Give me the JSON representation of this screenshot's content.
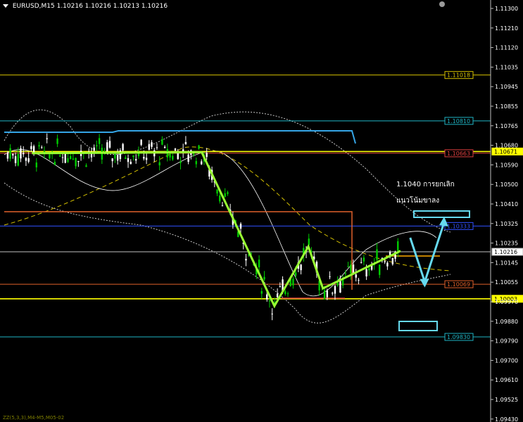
{
  "header": {
    "symbol": "EURUSD,M15",
    "quote": "1.10216 1.10216 1.10213 1.10216"
  },
  "footer": {
    "indicator": "ZZ(5,3,3),M4-M5,M05-02"
  },
  "annotation": {
    "line1": "1.1040 การยกเลิก",
    "line2": "แนวโน้มขาลง"
  },
  "colors": {
    "background": "#000000",
    "bull": "#00cc00",
    "bear": "#ffffff",
    "zigzag": "#99ff33",
    "arrow": "#66d9ef"
  },
  "chart_data": {
    "type": "candlestick",
    "title": "",
    "xlabel": "",
    "ylabel": "",
    "ylim": [
      1.0946,
      1.1132
    ],
    "y_ticks": [
      "1.11300",
      "1.11210",
      "1.11120",
      "1.11035",
      "1.10945",
      "1.10855",
      "1.10765",
      "1.10680",
      "1.10590",
      "1.10500",
      "1.10410",
      "1.10325",
      "1.10235",
      "1.10145",
      "1.10055",
      "1.09970",
      "1.09880",
      "1.09790",
      "1.09700",
      "1.09610",
      "1.09525",
      "1.09430"
    ],
    "levels": [
      {
        "value": 1.11018,
        "label": "1.11018",
        "color": "#d4c000"
      },
      {
        "value": 1.1081,
        "label": "1.10810",
        "color": "#1fb5c5"
      },
      {
        "value": 1.10671,
        "label": "1.10671",
        "color": "#ffff00"
      },
      {
        "value": 1.10663,
        "label": "1.10663",
        "color": "#e04040"
      },
      {
        "value": 1.10333,
        "label": "1.10333",
        "color": "#3050ff"
      },
      {
        "value": 1.10216,
        "label": "1.10216",
        "color": "#c0c0c0"
      },
      {
        "value": 1.10069,
        "label": "1.10069",
        "color": "#e0602a"
      },
      {
        "value": 1.10003,
        "label": "1.10003",
        "color": "#ffff00"
      },
      {
        "value": 1.0983,
        "label": "1.09830",
        "color": "#1fb5c5"
      }
    ],
    "zigzag": [
      {
        "i": 0.06,
        "v": 1.10663
      },
      {
        "i": 0.41,
        "v": 1.10668
      },
      {
        "i": 0.56,
        "v": 1.0997
      },
      {
        "i": 0.63,
        "v": 1.1024
      },
      {
        "i": 0.66,
        "v": 1.1005
      },
      {
        "i": 0.82,
        "v": 1.1022
      }
    ],
    "forecast": [
      {
        "i": 0.84,
        "v": 1.1028
      },
      {
        "i": 0.87,
        "v": 1.1008
      },
      {
        "i": 0.91,
        "v": 1.1035
      }
    ]
  }
}
